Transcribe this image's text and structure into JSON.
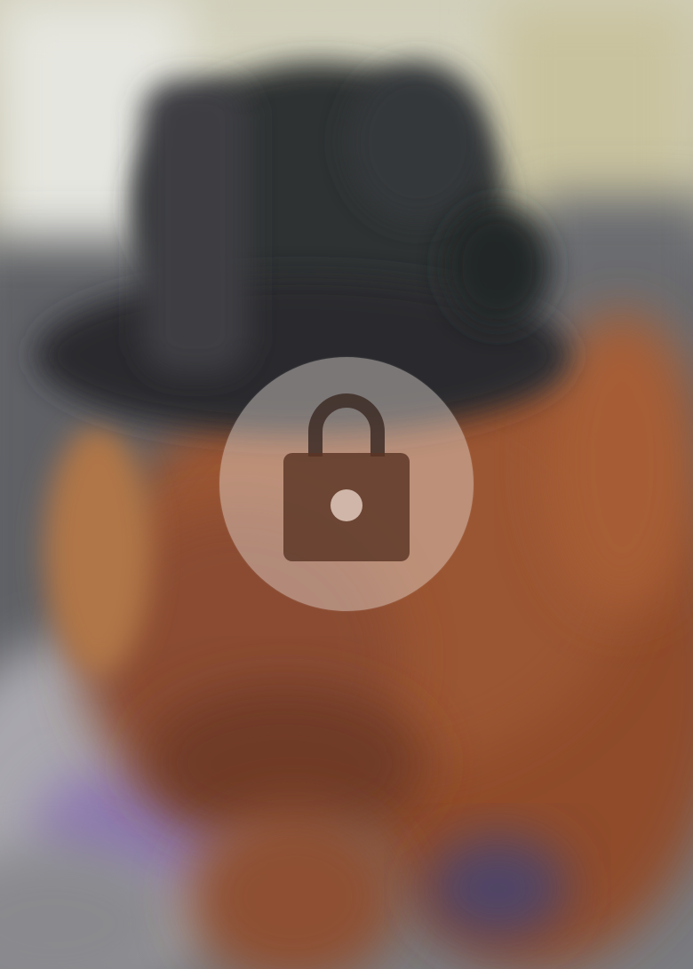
{
  "photo": {
    "icon": "blurred-photo",
    "state": "locked"
  },
  "lock_overlay": {
    "icon": "lock-icon",
    "colors": {
      "circle": "#ece2dc",
      "lock": "#4a2e24"
    }
  }
}
